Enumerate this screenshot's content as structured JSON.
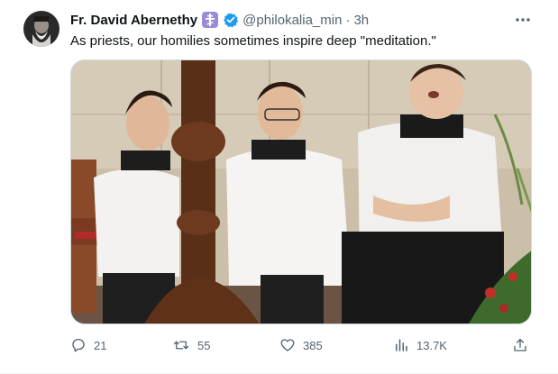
{
  "post": {
    "author_name": "Fr. David Abernethy",
    "handle": "@philokalia_min",
    "separator": "·",
    "time": "3h",
    "text": "As priests, our homilies sometimes inspire deep \"meditation.\"",
    "media_icon": "photo-of-altar-servers",
    "badges": [
      "orthodox-cross-icon",
      "verified-badge-icon"
    ],
    "badge_colors": {
      "cross_bg": "#9b8bd6",
      "verified": "#1d9bf0"
    }
  },
  "actions": {
    "replies": "21",
    "reposts": "55",
    "likes": "385",
    "views": "13.7K"
  },
  "icons": {
    "more": "more-icon",
    "reply": "reply-icon",
    "repost": "repost-icon",
    "like": "heart-icon",
    "views": "views-icon",
    "share": "share-icon"
  }
}
